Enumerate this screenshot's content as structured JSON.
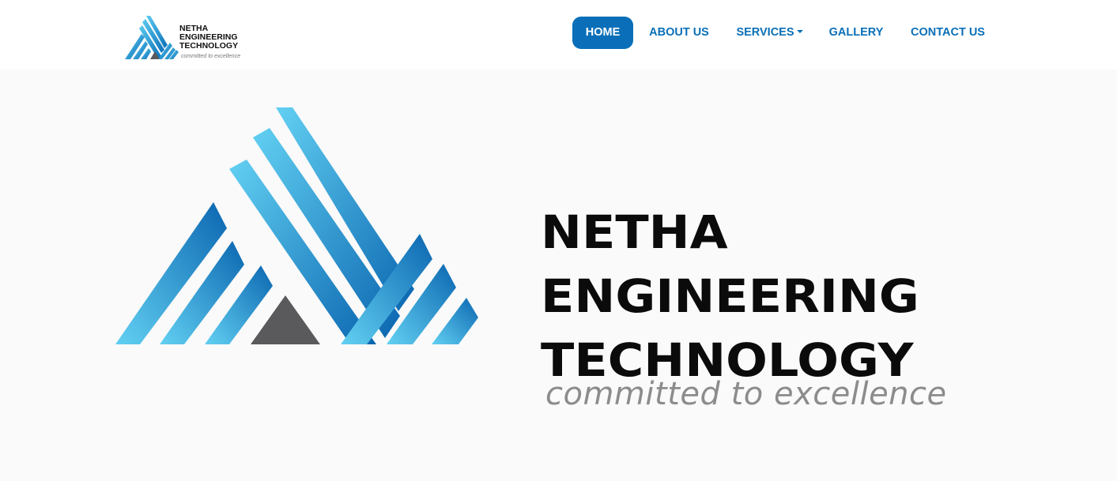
{
  "brand": {
    "logo_icon": "netha-triangle-logo-icon",
    "line1": "NETHA",
    "line2": "ENGINEERING",
    "line3": "TECHNOLOGY",
    "tagline": "committed to excellence"
  },
  "nav": {
    "items": [
      {
        "label": "HOME",
        "active": true
      },
      {
        "label": "ABOUT US",
        "active": false
      },
      {
        "label": "SERVICES",
        "active": false,
        "has_dropdown": true
      },
      {
        "label": "GALLERY",
        "active": false
      },
      {
        "label": "CONTACT US",
        "active": false
      }
    ]
  },
  "hero": {
    "logo_icon": "netha-triangle-logo-icon",
    "line1": "NETHA",
    "line2": "ENGINEERING",
    "line3": "TECHNOLOGY",
    "tagline": "committed to excellence"
  },
  "colors": {
    "primary": "#0a6fb8",
    "stripe_light": "#4fc3ea",
    "stripe_dark": "#0a6fb8",
    "triangle_gray": "#5a5a5c",
    "background": "#fafafa"
  }
}
